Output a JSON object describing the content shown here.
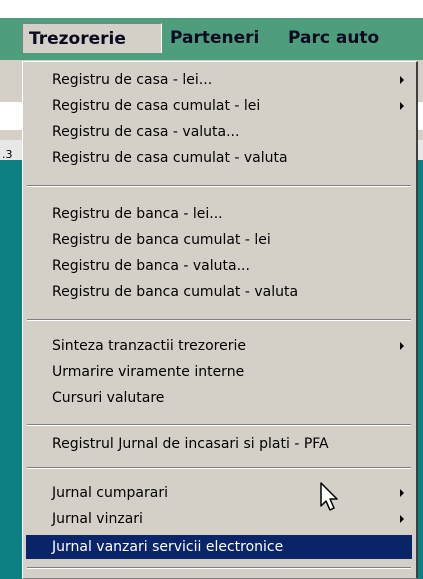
{
  "menubar": {
    "items": [
      {
        "label": "Trezorerie",
        "active": true
      },
      {
        "label": "Parteneri"
      },
      {
        "label": "Parc auto"
      }
    ]
  },
  "background": {
    "edge_mark": ".3"
  },
  "menu": {
    "items": [
      {
        "label": "Registru de casa - lei...",
        "submenu": true
      },
      {
        "label": "Registru de casa cumulat - lei",
        "submenu": true
      },
      {
        "label": "Registru de casa - valuta..."
      },
      {
        "label": "Registru de casa cumulat - valuta"
      },
      {
        "label": "Registru de banca - lei..."
      },
      {
        "label": "Registru de banca cumulat - lei"
      },
      {
        "label": "Registru de banca - valuta..."
      },
      {
        "label": "Registru de banca cumulat - valuta"
      },
      {
        "label": "Sinteza tranzactii trezorerie",
        "submenu": true
      },
      {
        "label": "Urmarire viramente interne"
      },
      {
        "label": "Cursuri valutare"
      },
      {
        "label": "Registrul Jurnal de incasari si plati - PFA"
      },
      {
        "label": "Jurnal cumparari",
        "submenu": true
      },
      {
        "label": "Jurnal vinzari",
        "submenu": true
      },
      {
        "label": "Jurnal vanzari servicii electronice",
        "selected": true
      }
    ]
  },
  "colors": {
    "menubar_bg": "#4e9e7d",
    "menu_bg": "#d4d0c8",
    "selection_bg": "#0a246a",
    "desktop_teal": "#0b7f82"
  }
}
